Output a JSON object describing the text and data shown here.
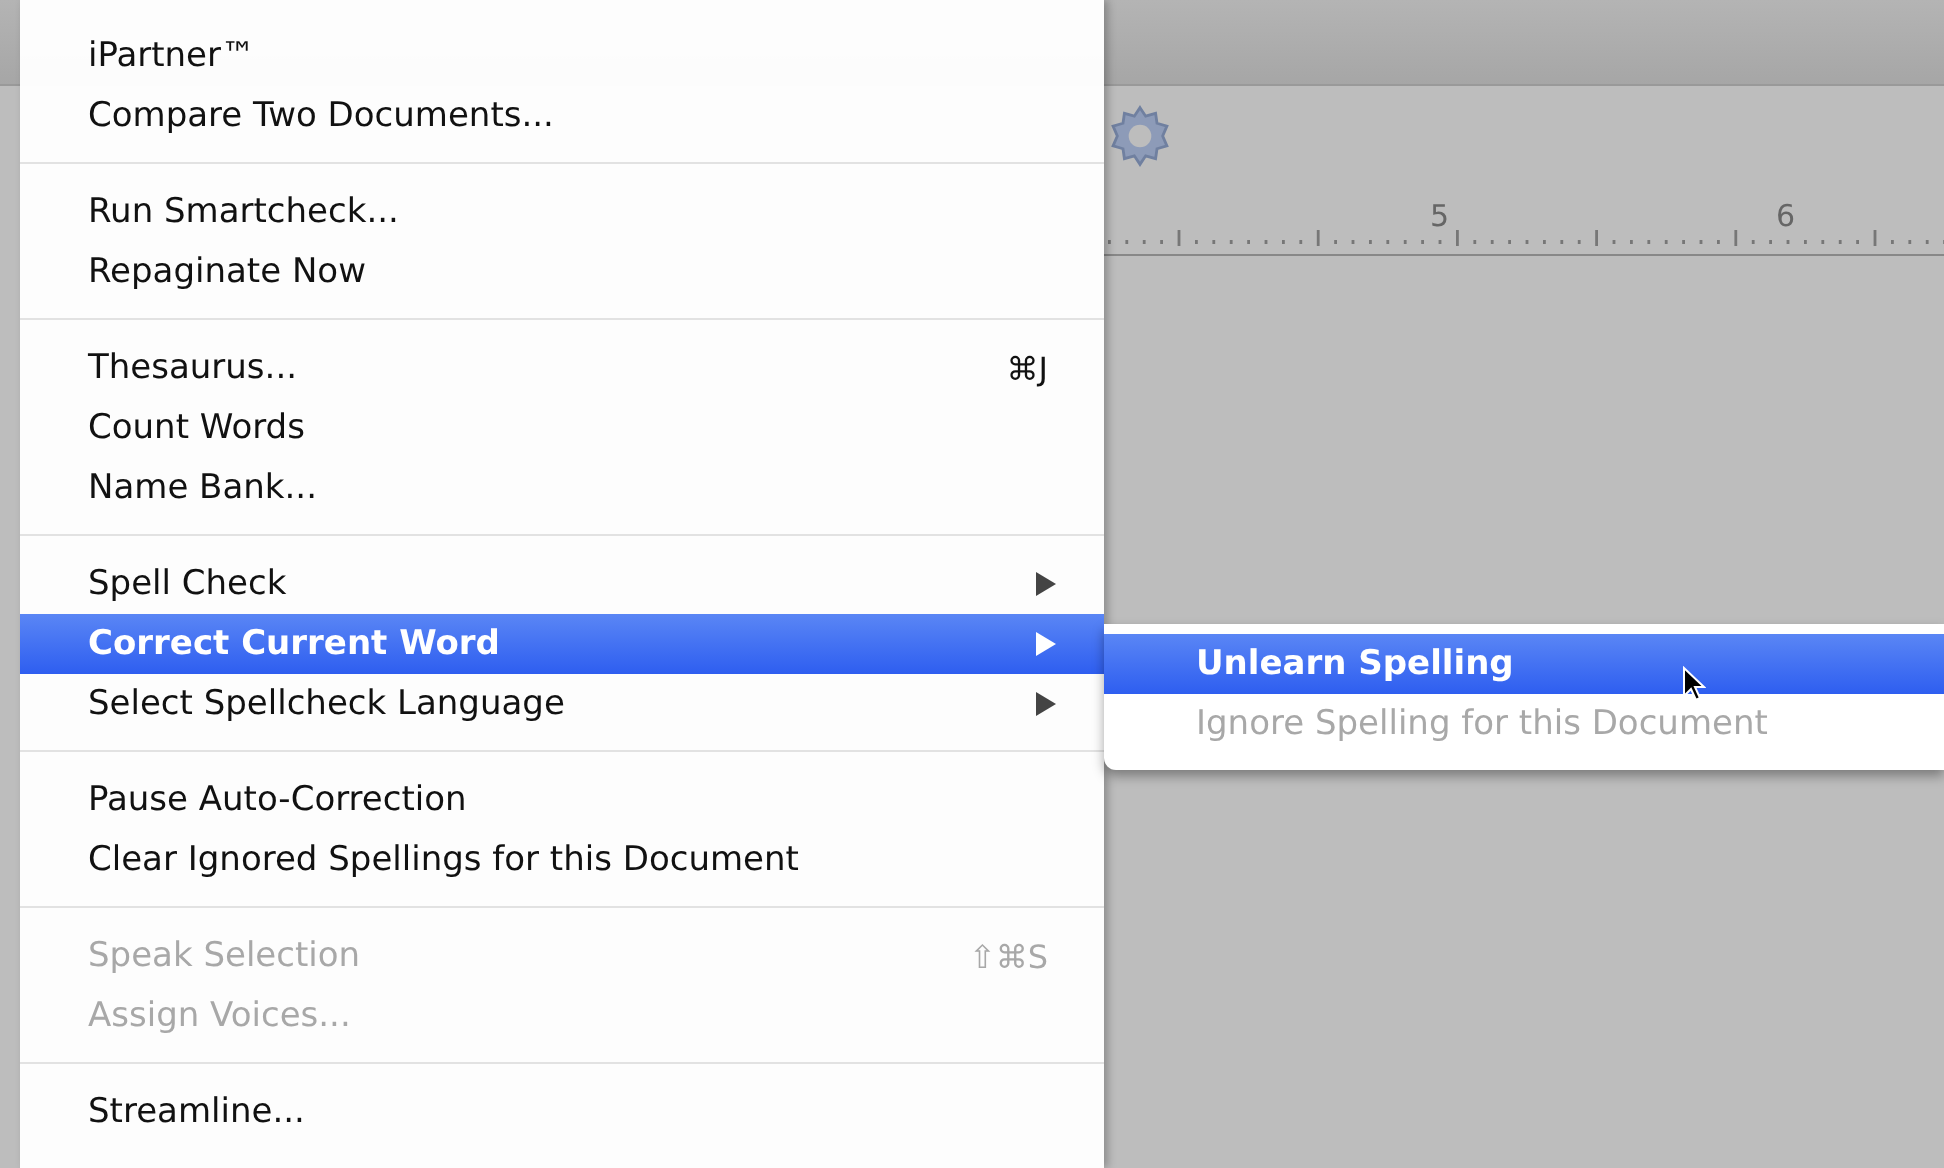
{
  "ruler": {
    "labels": [
      "5",
      "6"
    ]
  },
  "menu": {
    "sections": [
      [
        {
          "label": "iPartner™",
          "disabled": false,
          "selected": false,
          "submenu": false
        },
        {
          "label": "Compare Two Documents...",
          "disabled": false,
          "selected": false,
          "submenu": false
        }
      ],
      [
        {
          "label": "Run Smartcheck...",
          "disabled": false,
          "selected": false,
          "submenu": false
        },
        {
          "label": "Repaginate Now",
          "disabled": false,
          "selected": false,
          "submenu": false
        }
      ],
      [
        {
          "label": "Thesaurus...",
          "shortcut": "⌘J",
          "disabled": false,
          "selected": false,
          "submenu": false
        },
        {
          "label": "Count Words",
          "disabled": false,
          "selected": false,
          "submenu": false
        },
        {
          "label": "Name Bank...",
          "disabled": false,
          "selected": false,
          "submenu": false
        }
      ],
      [
        {
          "label": "Spell Check",
          "disabled": false,
          "selected": false,
          "submenu": true
        },
        {
          "label": "Correct Current Word",
          "disabled": false,
          "selected": true,
          "submenu": true
        },
        {
          "label": "Select Spellcheck Language",
          "disabled": false,
          "selected": false,
          "submenu": true
        }
      ],
      [
        {
          "label": "Pause Auto-Correction",
          "disabled": false,
          "selected": false,
          "submenu": false
        },
        {
          "label": "Clear Ignored Spellings for this Document",
          "disabled": false,
          "selected": false,
          "submenu": false
        }
      ],
      [
        {
          "label": "Speak Selection",
          "shortcut": "⇧⌘S",
          "disabled": true,
          "selected": false,
          "submenu": false
        },
        {
          "label": "Assign Voices...",
          "disabled": true,
          "selected": false,
          "submenu": false
        }
      ],
      [
        {
          "label": "Streamline...",
          "disabled": false,
          "selected": false,
          "submenu": false
        }
      ]
    ]
  },
  "submenu": {
    "items": [
      {
        "label": "Unlearn Spelling",
        "selected": true,
        "disabled": false
      },
      {
        "label": "Ignore Spelling for this Document",
        "selected": false,
        "disabled": true
      }
    ]
  }
}
